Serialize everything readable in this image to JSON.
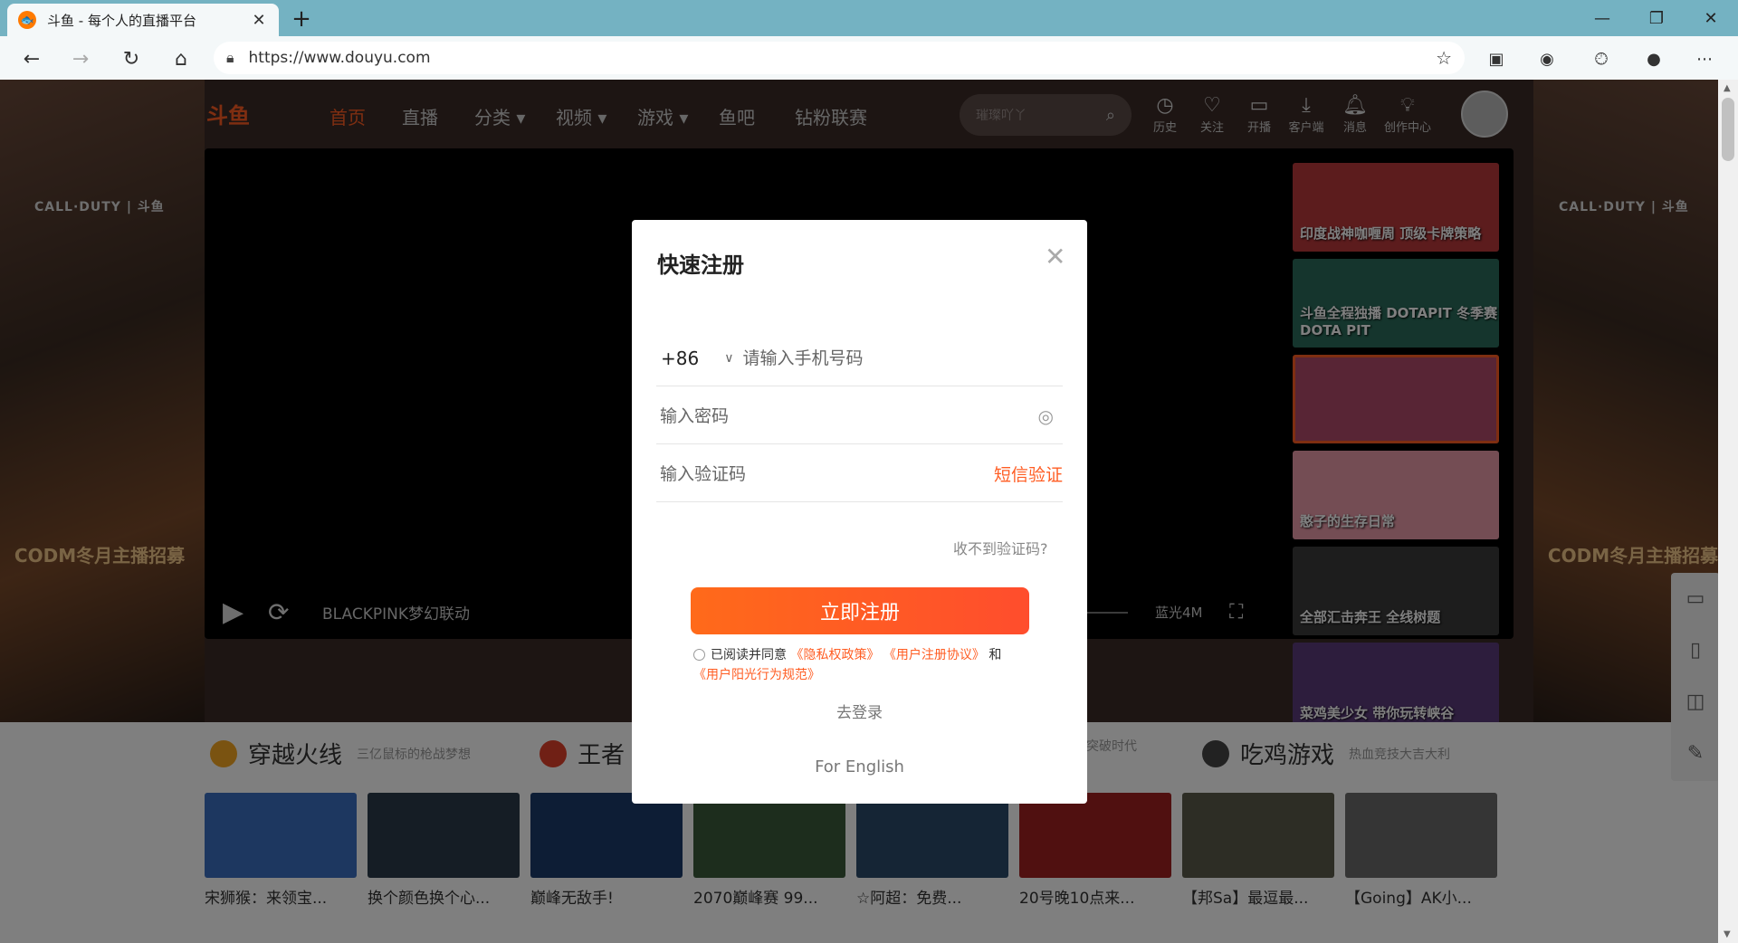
{
  "browser": {
    "tab_title": "斗鱼 - 每个人的直播平台",
    "tab_favicon": "douyu-favicon",
    "url": "https://www.douyu.com",
    "window_buttons": [
      "minimize-icon",
      "restore-icon",
      "close-icon"
    ]
  },
  "site": {
    "logo_text": "斗鱼",
    "nav": [
      "首页",
      "直播",
      "分类 ▾",
      "视频 ▾",
      "游戏 ▾",
      "鱼吧",
      "钻粉联赛"
    ],
    "search_placeholder": "璀璨吖丫",
    "header_items": [
      "历史",
      "关注",
      "开播",
      "客户端",
      "消息",
      "创作中心"
    ],
    "side_codm_logo": "CALL·DUTY | 斗鱼",
    "side_codm_banner": "CODM冬月主播招募"
  },
  "player": {
    "video_title": "BLACKPINK梦幻联动",
    "quality": "蓝光4M",
    "playlist": [
      {
        "caption": "印度战神咖喱周 顶级卡牌策略",
        "color": "#b8383a"
      },
      {
        "caption": "斗鱼全程独播 DOTAPIT 冬季赛 DOTA PIT",
        "color": "#2a6b5a"
      },
      {
        "caption": "",
        "color": "#b04a6a"
      },
      {
        "caption": "憨子的生存日常",
        "color": "#e89aa8"
      },
      {
        "caption": "全部汇击奔王 全线树题",
        "color": "#3a3a3a"
      },
      {
        "caption": "菜鸡美少女 带你玩转峡谷",
        "color": "#5a3a7a"
      }
    ]
  },
  "sections": [
    {
      "name": "穿越火线",
      "sub": "三亿鼠标的枪战梦想",
      "icon_color": "#f5a623"
    },
    {
      "name": "王者",
      "sub": "",
      "icon_color": "#e0402a"
    },
    {
      "name": "",
      "sub": "突破时代",
      "icon_color": ""
    },
    {
      "name": "吃鸡游戏",
      "sub": "热血竞技大吉大利",
      "icon_color": "#444"
    }
  ],
  "cards": [
    {
      "title": "宋狮猴：来领宝...",
      "color": "#3a6fc0"
    },
    {
      "title": "换个颜色换个心...",
      "color": "#2a3a4a"
    },
    {
      "title": "巅峰无敌手!",
      "color": "#1a3a6a"
    },
    {
      "title": "2070巅峰赛 99...",
      "color": "#3a5a3a"
    },
    {
      "title": "☆阿超：免费...",
      "color": "#2a4a6a"
    },
    {
      "title": "20号晚10点来...",
      "color": "#a02020"
    },
    {
      "title": "【邦Sa】最逗最...",
      "color": "#5a5a4a"
    },
    {
      "title": "【Going】AK小...",
      "color": "#6a6a6a"
    }
  ],
  "modal": {
    "title": "快速注册",
    "country_code": "+86",
    "phone_placeholder": "请输入手机号码",
    "password_placeholder": "输入密码",
    "code_placeholder": "输入验证码",
    "sms_label": "短信验证",
    "no_code": "收不到验证码?",
    "submit": "立即注册",
    "agree_prefix": "已阅读并同意",
    "privacy": "《隐私权政策》",
    "user_agreement": "《用户注册协议》",
    "and": "和",
    "conduct": "《用户阳光行为规范》",
    "go_login": "去登录",
    "for_english": "For English"
  },
  "colors": {
    "accent": "#ff5d23",
    "browser_frame": "#74b2c2"
  }
}
